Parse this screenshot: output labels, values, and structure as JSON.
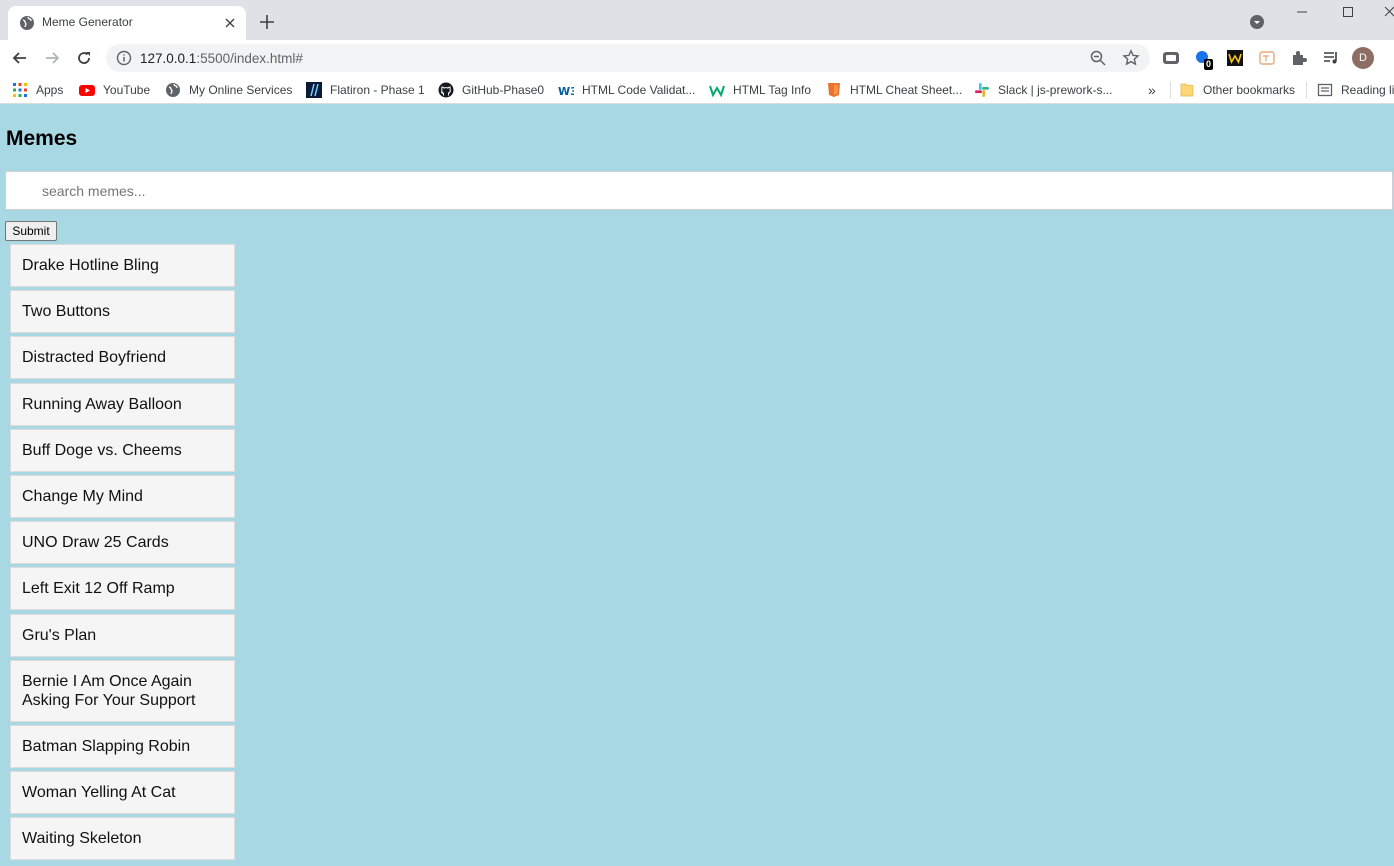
{
  "browser": {
    "tab_title": "Meme Generator",
    "url_host": "127.0.0.1",
    "url_rest": ":5500/index.html#",
    "avatar_letter": "D",
    "extension_badge": "0"
  },
  "bookmarks": {
    "items": [
      {
        "label": "Apps",
        "icon": "apps-grid-icon"
      },
      {
        "label": "YouTube",
        "icon": "youtube-icon"
      },
      {
        "label": "My Online Services",
        "icon": "globe-icon"
      },
      {
        "label": "Flatiron - Phase 1",
        "icon": "flatiron-icon"
      },
      {
        "label": "GitHub-Phase0",
        "icon": "github-icon"
      },
      {
        "label": "HTML Code Validat...",
        "icon": "w3c-icon"
      },
      {
        "label": "HTML Tag Info",
        "icon": "w3schools-icon"
      },
      {
        "label": "HTML Cheat Sheet...",
        "icon": "html5-icon"
      },
      {
        "label": "Slack | js-prework-s...",
        "icon": "slack-icon"
      }
    ],
    "overflow": "»",
    "other": "Other bookmarks",
    "reading": "Reading li"
  },
  "page": {
    "heading": "Memes",
    "search_placeholder": "search memes...",
    "submit_label": "Submit",
    "memes": [
      "Drake Hotline Bling",
      "Two Buttons",
      "Distracted Boyfriend",
      "Running Away Balloon",
      "Buff Doge vs. Cheems",
      "Change My Mind",
      "UNO Draw 25 Cards",
      "Left Exit 12 Off Ramp",
      "Gru's Plan",
      "Bernie I Am Once Again Asking For Your Support",
      "Batman Slapping Robin",
      "Woman Yelling At Cat",
      "Waiting Skeleton"
    ]
  }
}
